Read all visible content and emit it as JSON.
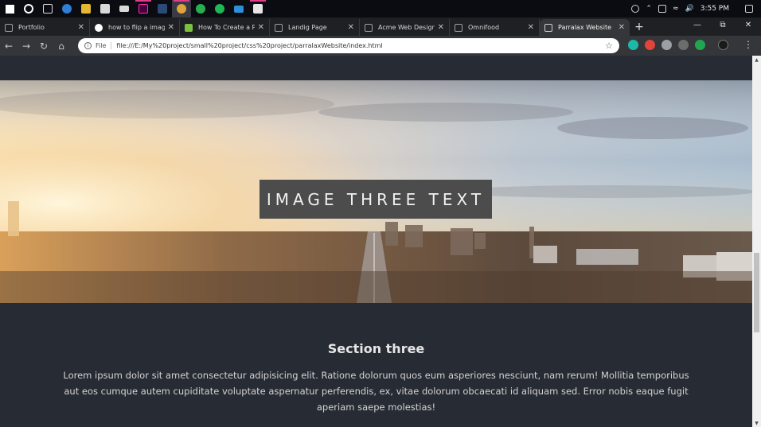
{
  "taskbar": {
    "clock": "3:55 PM",
    "apps": [
      {
        "name": "start",
        "color": "#ffffff"
      },
      {
        "name": "cortana",
        "color": "#ffffff"
      },
      {
        "name": "task-view",
        "color": "#cfcfcf"
      },
      {
        "name": "edge",
        "color": "#2f7fd6"
      },
      {
        "name": "file-explorer",
        "color": "#e5b834"
      },
      {
        "name": "store",
        "color": "#d9d9d9"
      },
      {
        "name": "mail",
        "color": "#d9d9d9"
      },
      {
        "name": "adobe-xd",
        "color": "#ff2bc2"
      },
      {
        "name": "terminal",
        "color": "#2c4a78"
      },
      {
        "name": "chrome",
        "color": "#e0a53a"
      },
      {
        "name": "app-green",
        "color": "#28b050"
      },
      {
        "name": "spotify",
        "color": "#1db954"
      },
      {
        "name": "monitor",
        "color": "#2c8fd8"
      },
      {
        "name": "photos",
        "color": "#e6e6e6"
      }
    ]
  },
  "tabs": [
    {
      "title": "Portfolio",
      "active": false,
      "color": "#9aa0a6"
    },
    {
      "title": "how to flip a imag",
      "active": false,
      "color": "#ffffff"
    },
    {
      "title": "How To Create a P",
      "active": false,
      "color": "#7cc040"
    },
    {
      "title": "Landig Page",
      "active": false,
      "color": "#9aa0a6"
    },
    {
      "title": "Acme Web Design",
      "active": false,
      "color": "#9aa0a6"
    },
    {
      "title": "Omnifood",
      "active": false,
      "color": "#9aa0a6"
    },
    {
      "title": "Parralax Website",
      "active": true,
      "color": "#9aa0a6"
    }
  ],
  "omnibox": {
    "scheme": "File",
    "url": "file:///E:/My%20project/small%20project/css%20project/parralaxWebsite/index.html"
  },
  "extensions": [
    {
      "name": "ext-m",
      "color": "#1fb8a8"
    },
    {
      "name": "ext-red",
      "color": "#e0453a"
    },
    {
      "name": "ext-camera",
      "color": "#9aa0a6"
    },
    {
      "name": "ext-mh",
      "color": "#6c6c6c"
    },
    {
      "name": "ext-green",
      "color": "#21a650"
    },
    {
      "name": "ext-avatar",
      "color": "#2b2b2b"
    }
  ],
  "hero": {
    "label": "IMAGE THREE TEXT"
  },
  "section": {
    "title": "Section three",
    "body": "Lorem ipsum dolor sit amet consectetur adipisicing elit. Ratione dolorum quos eum asperiores nesciunt, nam rerum! Mollitia temporibus aut eos cumque autem cupiditate voluptate aspernatur perferendis, ex, vitae dolorum obcaecati id aliquam sed. Error nobis eaque fugit aperiam saepe molestias!"
  }
}
